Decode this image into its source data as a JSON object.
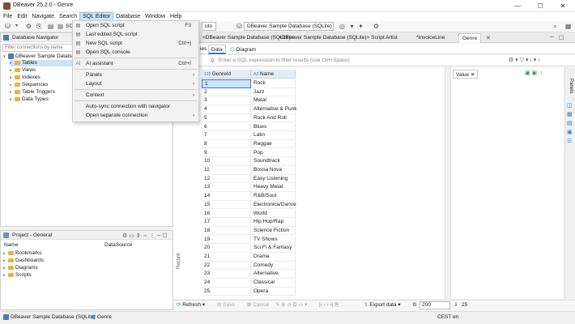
{
  "window": {
    "title": "DBeaver 25.2.0 - Genre",
    "minimize": "—",
    "maximize": "☐",
    "close": "✕"
  },
  "menu": [
    "File",
    "Edit",
    "Navigate",
    "Search",
    "SQL Editor",
    "Database",
    "Window",
    "Help"
  ],
  "toolbar": {
    "sql_label": "SC",
    "auto_label": "uto",
    "db_combo": "DBeaver Sample Database (SQLite)"
  },
  "sql_editor_menu": {
    "items": [
      {
        "label": "Open SQL script",
        "shortcut": "F3"
      },
      {
        "label": "Last edited SQL script",
        "shortcut": ""
      },
      {
        "label": "New SQL script",
        "shortcut": "Ctrl+]"
      },
      {
        "label": "Open SQL console",
        "shortcut": ""
      },
      {
        "label": "AI assistant",
        "shortcut": "Ctrl+I"
      },
      {
        "label": "Panels",
        "shortcut": ""
      },
      {
        "label": "Layout",
        "shortcut": ""
      },
      {
        "label": "Context",
        "shortcut": ""
      },
      {
        "label": "Auto-sync connection with navigator",
        "shortcut": ""
      },
      {
        "label": "Open separate connection",
        "shortcut": ""
      }
    ]
  },
  "navigator": {
    "tab": "Database Navigator",
    "filter_placeholder": "Filter connections by name",
    "db": "DBeaver Sample Database",
    "items": [
      "Tables",
      "Views",
      "Indexes",
      "Sequences",
      "Table Triggers",
      "Data Types"
    ]
  },
  "project": {
    "tab": "Project - General",
    "col_name": "Name",
    "col_datasource": "DataSource",
    "items": [
      "Bookmarks",
      "Dashboards",
      "Diagrams",
      "Scripts"
    ]
  },
  "editor_tabs": [
    "<DBeaver Sample Database (SQLite)>",
    "<DBeaver Sample Database (SQLite)> Script",
    "Artist",
    "*InvoiceLine",
    "Genre"
  ],
  "sub_tabs": [
    "ies",
    "Data",
    "Diagram"
  ],
  "filter_placeholder": "Enter a SQL expression to filter results (use Ctrl+Space)",
  "grid": {
    "col_id": "GenreId",
    "col_name": "Name",
    "rows": [
      [
        "1",
        "Rock"
      ],
      [
        "2",
        "Jazz"
      ],
      [
        "3",
        "Metal"
      ],
      [
        "4",
        "Alternative & Punk"
      ],
      [
        "5",
        "Rock And Roll"
      ],
      [
        "6",
        "Blues"
      ],
      [
        "7",
        "Latin"
      ],
      [
        "8",
        "Reggae"
      ],
      [
        "9",
        "Pop"
      ],
      [
        "10",
        "Soundtrack"
      ],
      [
        "11",
        "Bossa Nova"
      ],
      [
        "12",
        "Easy Listening"
      ],
      [
        "13",
        "Heavy Metal"
      ],
      [
        "14",
        "R&B/Soul"
      ],
      [
        "15",
        "Electronica/Dance"
      ],
      [
        "16",
        "World"
      ],
      [
        "17",
        "Hip Hop/Rap"
      ],
      [
        "18",
        "Science Fiction"
      ],
      [
        "19",
        "TV Shows"
      ],
      [
        "20",
        "Sci Fi & Fantasy"
      ],
      [
        "21",
        "Drama"
      ],
      [
        "22",
        "Comedy"
      ],
      [
        "23",
        "Alternative"
      ],
      [
        "24",
        "Classical"
      ],
      [
        "25",
        "Opera"
      ]
    ],
    "record_label": "Record"
  },
  "value_panel": {
    "label": "Value"
  },
  "side_panel_label": "Panels",
  "bottom_bar": {
    "refresh": "Refresh",
    "save": "Save",
    "cancel": "Cancel",
    "export": "Export data",
    "fetch_size": "200",
    "count": "25"
  },
  "status": {
    "db": "DBeaver Sample Database (SQLite)",
    "table": "Genre",
    "tz": "CEST",
    "locale": "en"
  }
}
